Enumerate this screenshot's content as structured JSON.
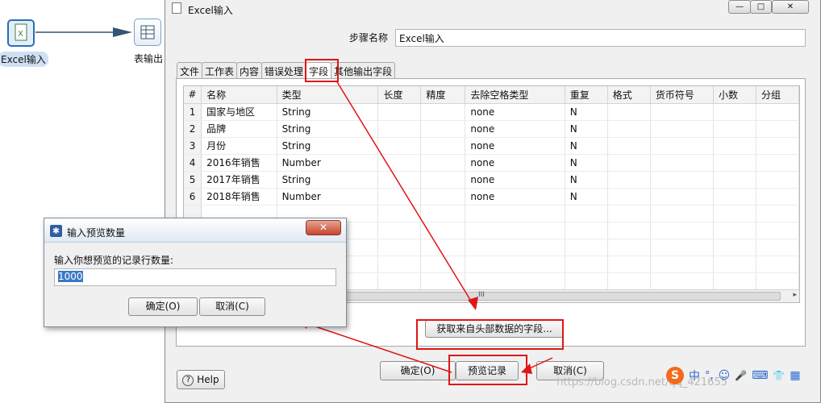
{
  "canvas": {
    "source_step_label": "Excel输入",
    "target_step_label": "表输出"
  },
  "dialog": {
    "title": "Excel输入",
    "window_buttons": [
      "—",
      "□",
      "✕"
    ],
    "step_name_label": "步骤名称",
    "step_name_value": "Excel输入",
    "tabs": [
      "文件",
      "工作表",
      "内容",
      "错误处理",
      "字段",
      "其他输出字段"
    ],
    "active_tab": "字段",
    "columns": [
      "#",
      "名称",
      "类型",
      "长度",
      "精度",
      "去除空格类型",
      "重复",
      "格式",
      "货币符号",
      "小数",
      "分组"
    ],
    "rows": [
      [
        "1",
        "国家与地区",
        "String",
        "",
        "",
        "none",
        "N",
        "",
        "",
        "",
        ""
      ],
      [
        "2",
        "品牌",
        "String",
        "",
        "",
        "none",
        "N",
        "",
        "",
        "",
        ""
      ],
      [
        "3",
        "月份",
        "String",
        "",
        "",
        "none",
        "N",
        "",
        "",
        "",
        ""
      ],
      [
        "4",
        "2016年销售",
        "Number",
        "",
        "",
        "none",
        "N",
        "",
        "",
        "",
        ""
      ],
      [
        "5",
        "2017年销售",
        "String",
        "",
        "",
        "none",
        "N",
        "",
        "",
        "",
        ""
      ],
      [
        "6",
        "2018年销售",
        "Number",
        "",
        "",
        "none",
        "N",
        "",
        "",
        "",
        ""
      ]
    ],
    "scroll_thumb": "III",
    "get_fields_button": "获取来自头部数据的字段...",
    "help_button": "Help",
    "ok_button": "确定(O)",
    "preview_button": "预览记录",
    "cancel_button": "取消(C)"
  },
  "preview_dialog": {
    "title": "输入预览数量",
    "prompt": "输入你想预览的记录行数量:",
    "value": "1000",
    "ok_button": "确定(O)",
    "cancel_button": "取消(C)",
    "close": "✕"
  },
  "watermark": "https://blog.csdn.net/qq_421655",
  "taskbar": {
    "ime_glyph": "S",
    "ime_items": [
      "中",
      "°,",
      "☺",
      "🎤",
      "⌨",
      "👕",
      "▦"
    ]
  },
  "colors": {
    "annotation_red": "#e01515",
    "selection_blue": "#3a79c6"
  }
}
